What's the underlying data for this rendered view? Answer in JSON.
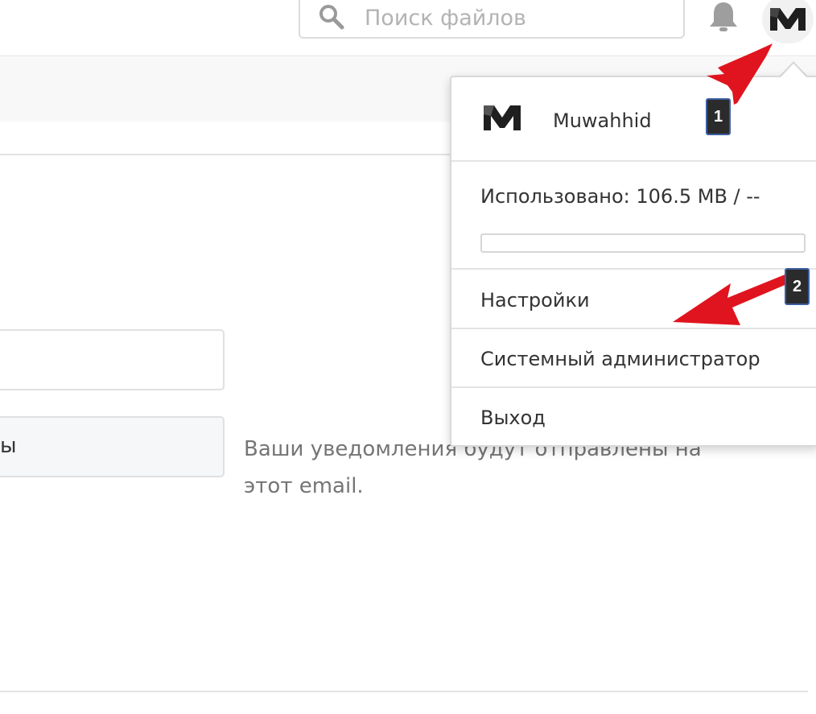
{
  "header": {
    "search_placeholder": "Поиск файлов",
    "icons": [
      "search-icon",
      "bell-icon",
      "avatar"
    ]
  },
  "form": {
    "field2_tail": "ы",
    "email_hint": "Ваши уведомления будут отправлены на этот email."
  },
  "menu": {
    "user_name": "Muwahhid",
    "quota_label": "Использовано: 106.5 MB / --",
    "quota_fraction": 0,
    "items": [
      {
        "label": "Настройки"
      },
      {
        "label": "Системный администратор"
      },
      {
        "label": "Выход"
      }
    ]
  },
  "annotations": {
    "badge1": "1",
    "badge2": "2",
    "arrow_color": "#e0141e"
  },
  "colors": {
    "accent": "#1e73be",
    "logo_dark": "#1f1f1f"
  }
}
